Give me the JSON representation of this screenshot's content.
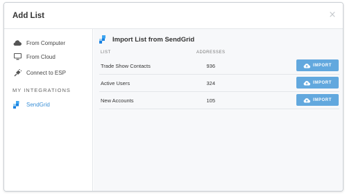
{
  "dialog": {
    "title": "Add List",
    "close_glyph": "×"
  },
  "sidebar": {
    "items": [
      {
        "label": "From Computer",
        "icon": "cloud-icon"
      },
      {
        "label": "From Cloud",
        "icon": "monitor-icon"
      },
      {
        "label": "Connect to ESP",
        "icon": "plug-icon"
      }
    ],
    "heading": "MY INTEGRATIONS",
    "integrations": [
      {
        "label": "SendGrid",
        "icon": "sendgrid-logo-icon",
        "active": true
      }
    ]
  },
  "main": {
    "title": "Import List from SendGrid",
    "columns": {
      "list": "LIST",
      "addresses": "ADDRESSES"
    },
    "rows": [
      {
        "name": "Trade Show Contacts",
        "count": "936",
        "action": "IMPORT"
      },
      {
        "name": "Active Users",
        "count": "324",
        "action": "IMPORT"
      },
      {
        "name": "New Accounts",
        "count": "105",
        "action": "IMPORT"
      }
    ]
  },
  "colors": {
    "accent": "#62a8de",
    "active_link": "#3a8fd6",
    "main_bg": "#f7f8fa"
  }
}
